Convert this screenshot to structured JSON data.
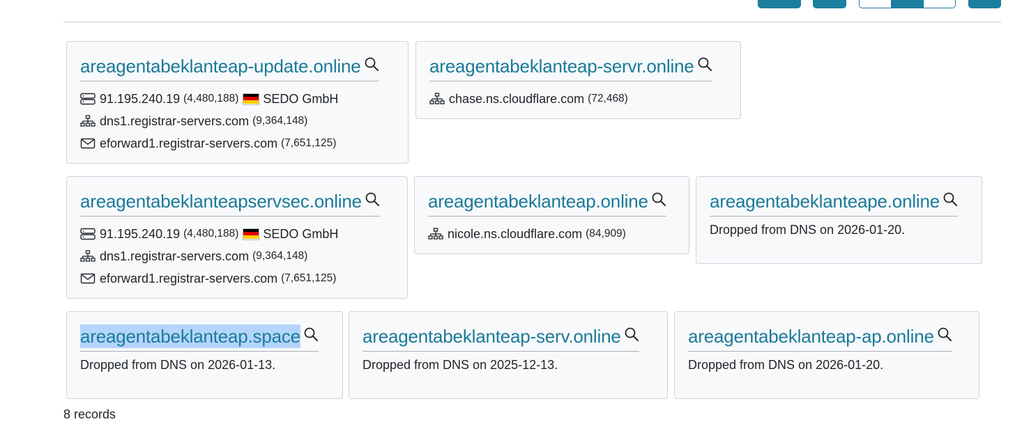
{
  "cards": [
    {
      "domain": "areagentabeklanteap-update.online",
      "ip": "91.195.240.19",
      "ip_count": "(4,480,188)",
      "org": "SEDO GmbH",
      "ns": "dns1.registrar-servers.com",
      "ns_count": "(9,364,148)",
      "mx": "eforward1.registrar-servers.com",
      "mx_count": "(7,651,125)"
    },
    {
      "domain": "areagentabeklanteap-servr.online",
      "ns": "chase.ns.cloudflare.com",
      "ns_count": "(72,468)"
    },
    {
      "domain": "areagentabeklanteapservsec.online",
      "ip": "91.195.240.19",
      "ip_count": "(4,480,188)",
      "org": "SEDO GmbH",
      "ns": "dns1.registrar-servers.com",
      "ns_count": "(9,364,148)",
      "mx": "eforward1.registrar-servers.com",
      "mx_count": "(7,651,125)"
    },
    {
      "domain": "areagentabeklanteap.online",
      "ns": "nicole.ns.cloudflare.com",
      "ns_count": "(84,909)"
    },
    {
      "domain": "areagentabeklanteape.online",
      "status": "Dropped from DNS on 2026-01-20."
    },
    {
      "domain": "areagentabeklanteap.space",
      "status": "Dropped from DNS on 2026-01-13."
    },
    {
      "domain": "areagentabeklanteap-serv.online",
      "status": "Dropped from DNS on 2025-12-13."
    },
    {
      "domain": "areagentabeklanteap-ap.online",
      "status": "Dropped from DNS on 2026-01-20."
    }
  ],
  "footer": {
    "records": "8 records"
  },
  "icons": {
    "server": "server-icon",
    "nameserver": "sitemap-icon",
    "mail": "envelope-icon",
    "search": "search-icon",
    "flag": "germany-flag-icon"
  },
  "colors": {
    "accent": "#1b7a99",
    "card_bg": "#f8f9fa",
    "card_border": "#ced4da",
    "highlight": "#b4d5fc"
  }
}
